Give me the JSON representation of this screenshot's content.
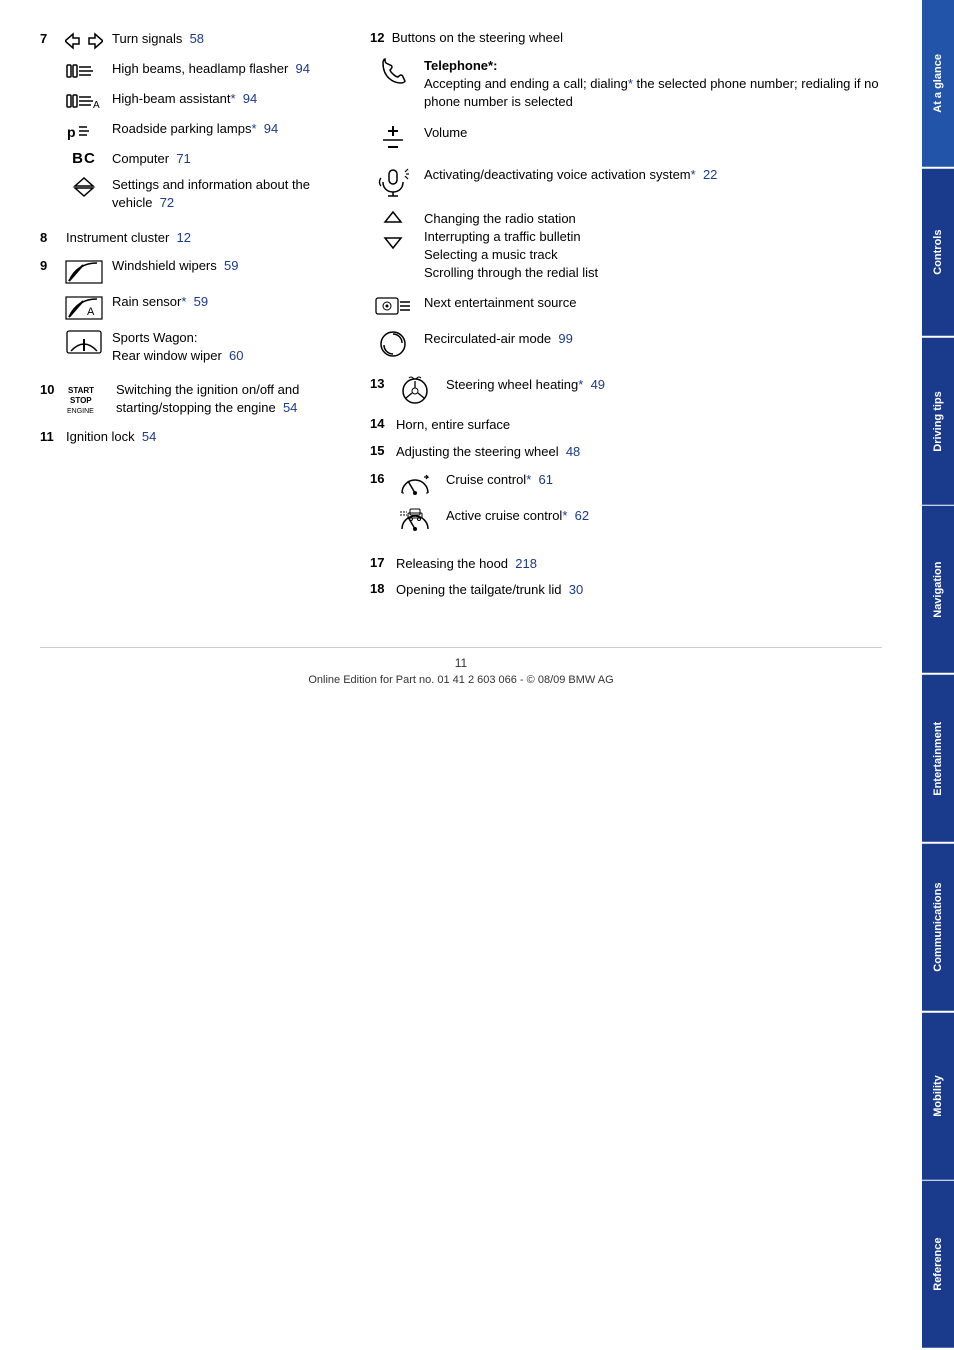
{
  "sidebar": {
    "tabs": [
      {
        "label": "At a glance",
        "active": true
      },
      {
        "label": "Controls",
        "active": false
      },
      {
        "label": "Driving tips",
        "active": false
      },
      {
        "label": "Navigation",
        "active": false
      },
      {
        "label": "Entertainment",
        "active": false
      },
      {
        "label": "Communications",
        "active": false
      },
      {
        "label": "Mobility",
        "active": false
      },
      {
        "label": "Reference",
        "active": false
      }
    ]
  },
  "left_column": {
    "item7": {
      "num": "7",
      "subitems": [
        {
          "label": "Turn signals",
          "page": "58"
        },
        {
          "label": "High beams, headlamp flasher",
          "page": "94"
        },
        {
          "label": "High-beam assistant*",
          "page": "94"
        },
        {
          "label": "Roadside parking lamps*",
          "page": "94"
        },
        {
          "label": "Computer",
          "page": "71"
        },
        {
          "label": "Settings and information about the vehicle",
          "page": "72"
        }
      ]
    },
    "item8": {
      "num": "8",
      "label": "Instrument cluster",
      "page": "12"
    },
    "item9": {
      "num": "9",
      "subitems": [
        {
          "label": "Windshield wipers",
          "page": "59"
        },
        {
          "label": "Rain sensor*",
          "page": "59"
        },
        {
          "label": "Sports Wagon:\nRear window wiper",
          "page": "60"
        }
      ]
    },
    "item10": {
      "num": "10",
      "label": "Switching the ignition on/off and starting/stopping the engine",
      "page": "54"
    },
    "item11": {
      "num": "11",
      "label": "Ignition lock",
      "page": "54"
    }
  },
  "right_column": {
    "header": "12  Buttons on the steering wheel",
    "subitems": [
      {
        "label": "Telephone*:",
        "description": "Accepting and ending a call; dialing* the selected phone number; redialing if no phone number is selected"
      },
      {
        "label": "Volume",
        "description": ""
      },
      {
        "label": "Activating/deactivating voice activation system*",
        "page": "22"
      },
      {
        "label": "Changing the radio station\nInterrupting a traffic bulletin\nSelecting a music track\nScrolling through the redial list",
        "description": ""
      },
      {
        "label": "Next entertainment source",
        "description": ""
      },
      {
        "label": "Recirculated-air mode",
        "page": "99"
      }
    ],
    "item13": {
      "num": "13",
      "label": "Steering wheel heating*",
      "page": "49"
    },
    "item14": {
      "num": "14",
      "label": "Horn, entire surface"
    },
    "item15": {
      "num": "15",
      "label": "Adjusting the steering wheel",
      "page": "48"
    },
    "item16": {
      "num": "16",
      "subitems": [
        {
          "label": "Cruise control*",
          "page": "61"
        },
        {
          "label": "Active cruise control*",
          "page": "62"
        }
      ]
    },
    "item17": {
      "num": "17",
      "label": "Releasing the hood",
      "page": "218"
    },
    "item18": {
      "num": "18",
      "label": "Opening the tailgate/trunk lid",
      "page": "30"
    }
  },
  "footer": {
    "page_num": "11",
    "text": "Online Edition for Part no. 01 41 2 603 066 - © 08/09 BMW AG"
  }
}
